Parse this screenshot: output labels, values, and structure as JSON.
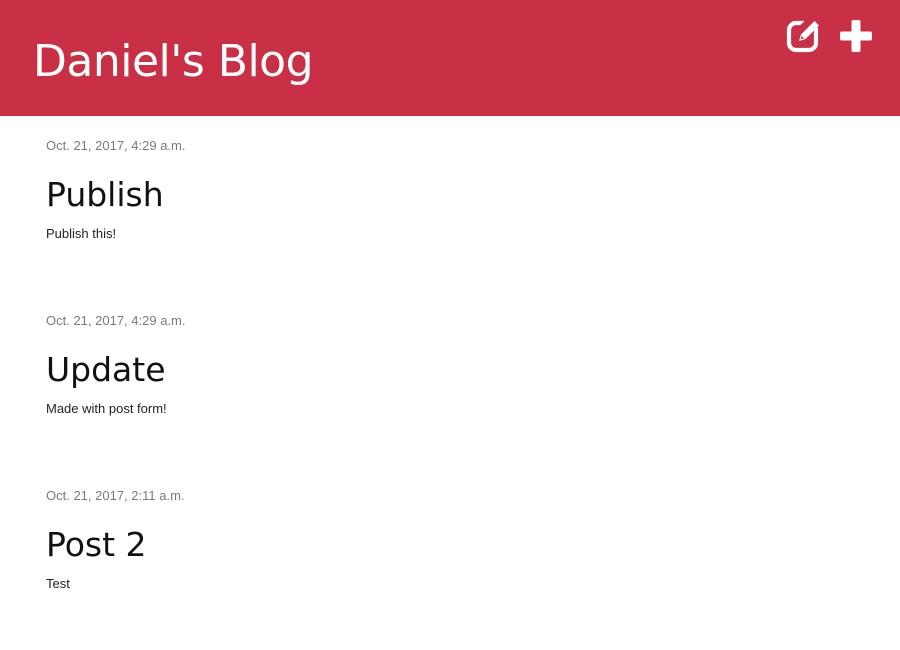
{
  "header": {
    "title": "Daniel's Blog",
    "background_color": "#c93045",
    "actions": [
      {
        "icon": "edit-icon",
        "label": "Edit"
      },
      {
        "icon": "plus-icon",
        "label": "New post"
      }
    ]
  },
  "posts": [
    {
      "date": "Oct. 21, 2017, 4:29 a.m.",
      "title": "Publish",
      "text": "Publish this!"
    },
    {
      "date": "Oct. 21, 2017, 4:29 a.m.",
      "title": "Update",
      "text": "Made with post form!"
    },
    {
      "date": "Oct. 21, 2017, 2:11 a.m.",
      "title": "Post 2",
      "text": "Test"
    }
  ]
}
